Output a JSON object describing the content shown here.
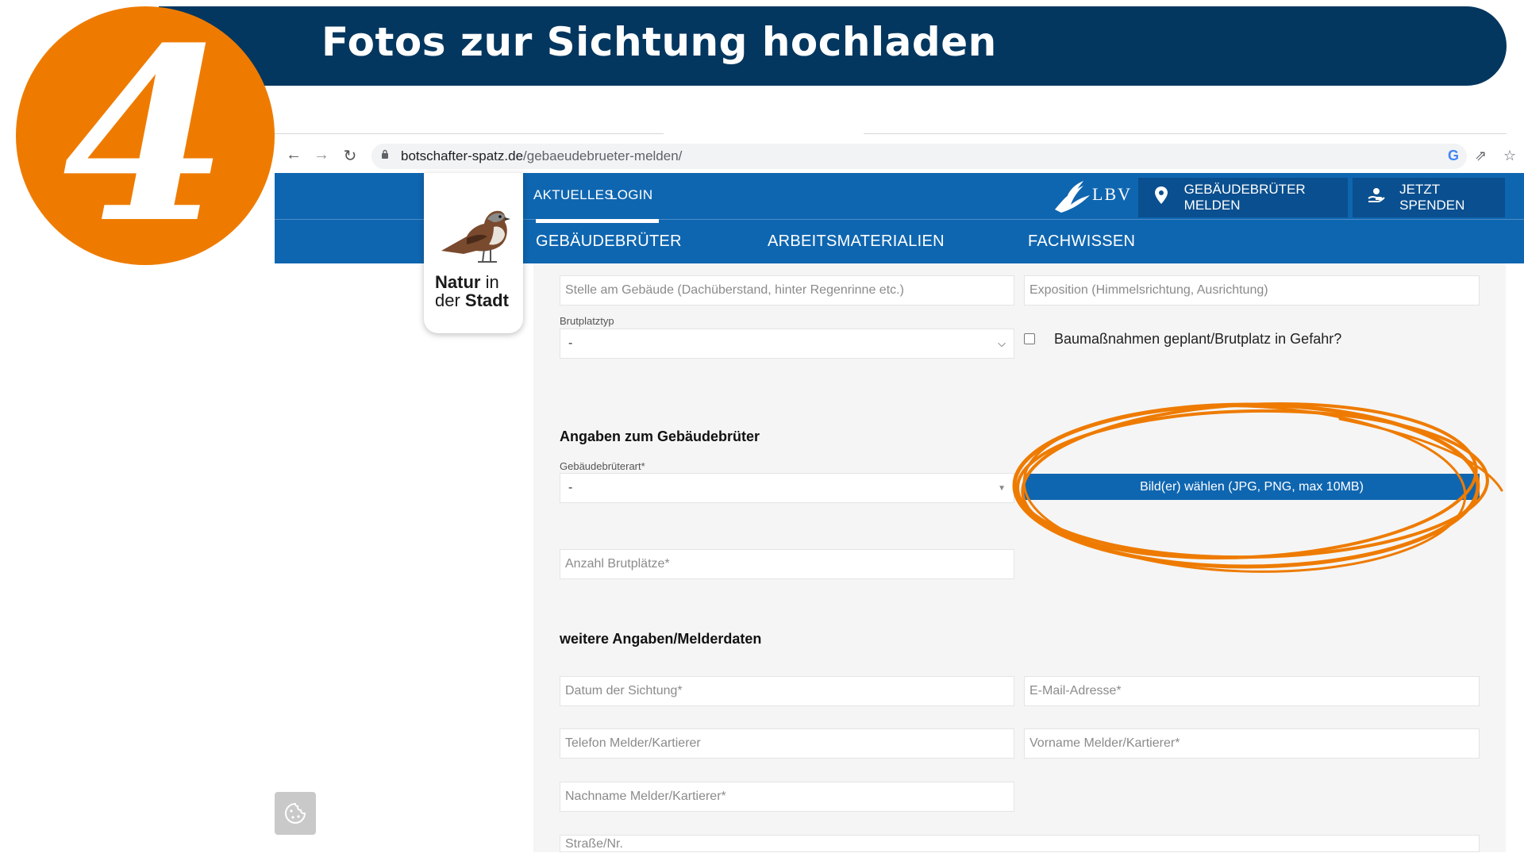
{
  "banner": {
    "title": "Fotos zur Sichtung hochladen",
    "step": "4",
    "accent_color": "#ee7b00",
    "bg_color": "#04375f"
  },
  "browser": {
    "back_icon": "arrow-left-icon",
    "forward_icon": "arrow-right-icon",
    "reload_icon": "reload-icon",
    "url_domain": "botschafter-spatz.de",
    "url_path": "/gebaeudebrueter-melden/",
    "icons": [
      "google-icon",
      "share-icon",
      "star-icon"
    ]
  },
  "site": {
    "brand_color": "#0f66b0",
    "top_links": [
      "AKTUELLES",
      "LOGIN"
    ],
    "lbv_logo": "LBV",
    "report_button": "GEBÄUDEBRÜTER MELDEN",
    "donate_button": "JETZT SPENDEN",
    "nav": [
      "GEBÄUDEBRÜTER",
      "ARBEITSMATERIALIEN",
      "FACHWISSEN"
    ],
    "logo_line1": "Natur",
    "logo_line1b": "in",
    "logo_line2a": "der",
    "logo_line2b": "Stadt"
  },
  "form": {
    "stelle_placeholder": "Stelle am Gebäude (Dachüberstand, hinter Regenrinne etc.)",
    "exposition_placeholder": "Exposition (Himmelsrichtung, Ausrichtung)",
    "brutplatztyp_label": "Brutplatztyp",
    "brutplatztyp_value": "-",
    "baumassnahmen_label": "Baumaßnahmen geplant/Brutplatz in Gefahr?",
    "section_gebaeudebrueter": "Angaben zum Gebäudebrüter",
    "art_label": "Gebäudebrüterart*",
    "art_value": "-",
    "upload_button": "Bild(er) wählen (JPG, PNG, max 10MB)",
    "anzahl_placeholder": "Anzahl Brutplätze*",
    "section_melder": "weitere Angaben/Melderdaten",
    "datum_placeholder": "Datum der Sichtung*",
    "email_placeholder": "E-Mail-Adresse*",
    "telefon_placeholder": "Telefon Melder/Kartierer",
    "vorname_placeholder": "Vorname Melder/Kartierer*",
    "nachname_placeholder": "Nachname Melder/Kartierer*",
    "strasse_placeholder": "Straße/Nr."
  },
  "cookie_icon": "cookie-icon"
}
